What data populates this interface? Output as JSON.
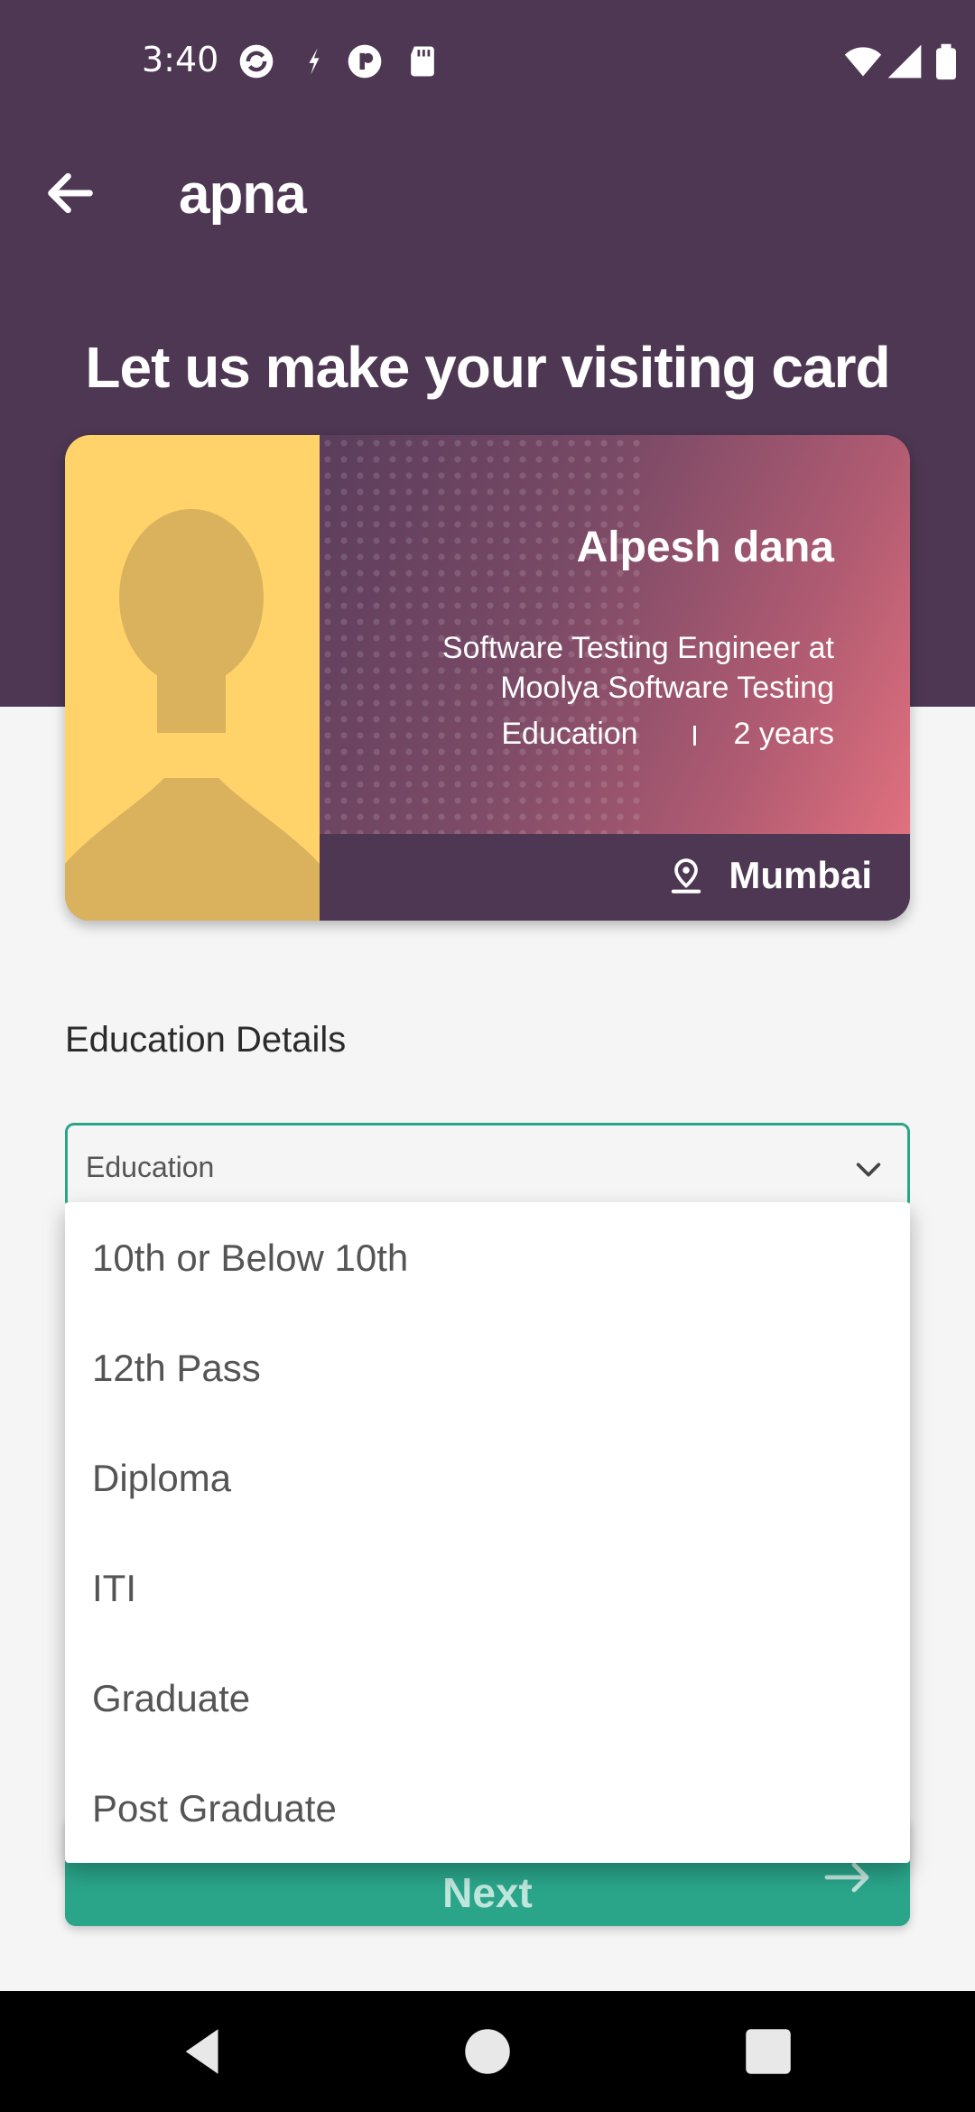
{
  "status_bar": {
    "time": "3:40"
  },
  "app_bar": {
    "title": "apna"
  },
  "hero": {
    "title": "Let us make your visiting card"
  },
  "card": {
    "name": "Alpesh dana",
    "role": "Software Testing Engineer at Moolya Software Testing",
    "education": "Education",
    "experience": "2 years",
    "city": "Mumbai"
  },
  "section": {
    "title": "Education Details"
  },
  "education_select": {
    "value": "Education"
  },
  "dropdown": {
    "options": [
      "10th or Below 10th",
      "12th Pass",
      "Diploma",
      "ITI",
      "Graduate",
      "Post Graduate"
    ]
  },
  "next_button": {
    "label": "Next"
  },
  "colors": {
    "header": "#4d3752",
    "accent": "#2aa58a",
    "photo_bg": "#ffd26a"
  }
}
